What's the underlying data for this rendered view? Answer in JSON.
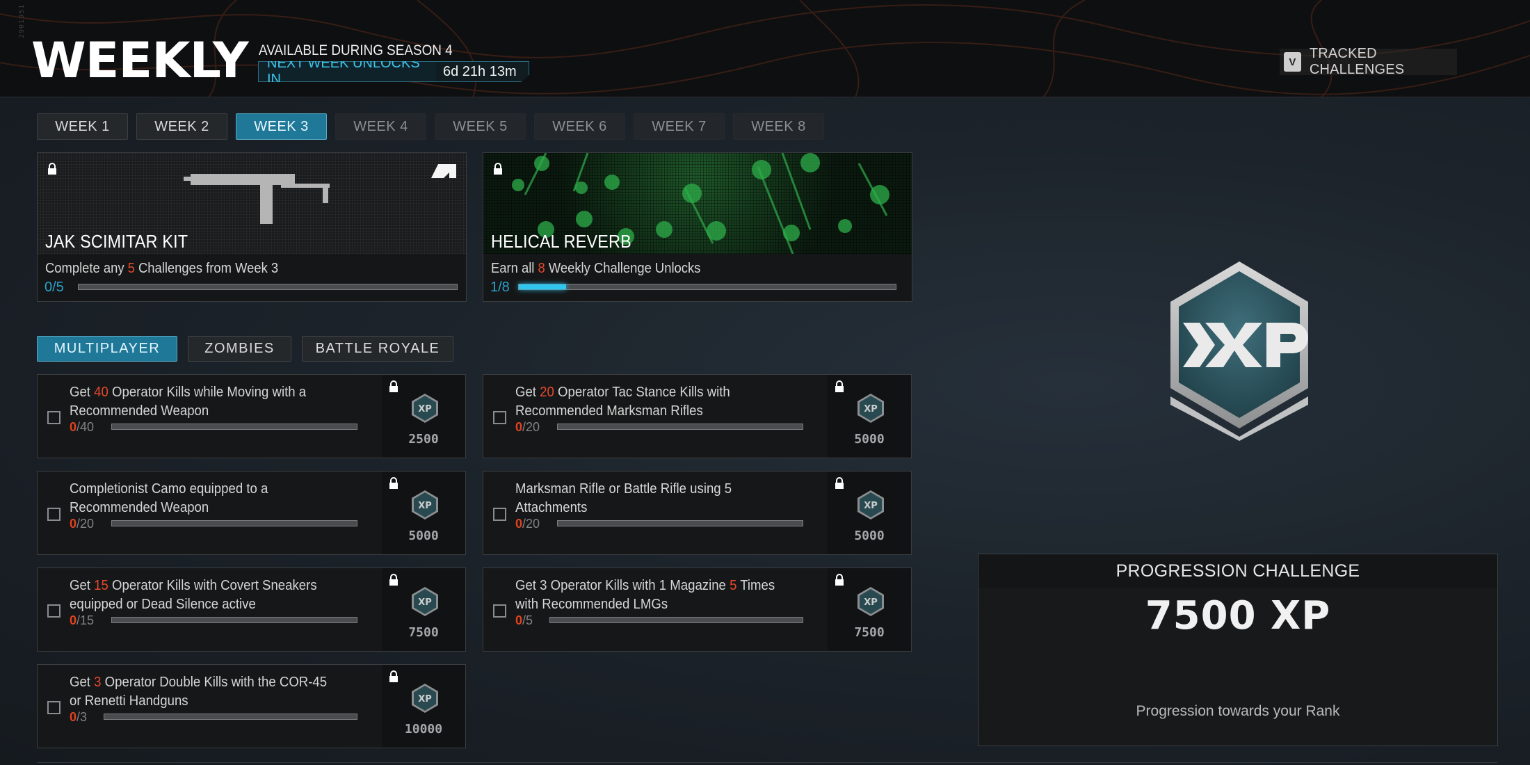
{
  "header": {
    "side_code": "2901951",
    "title": "WEEKLY",
    "availability": "AVAILABLE DURING SEASON 4",
    "unlock_label": "NEXT WEEK UNLOCKS IN",
    "unlock_time": "6d 21h 13m",
    "tracked": {
      "key": "V",
      "label": "TRACKED CHALLENGES"
    }
  },
  "weeks": [
    {
      "label": "WEEK 1",
      "state": "unlocked"
    },
    {
      "label": "WEEK 2",
      "state": "unlocked"
    },
    {
      "label": "WEEK 3",
      "state": "active"
    },
    {
      "label": "WEEK 4",
      "state": "locked"
    },
    {
      "label": "WEEK 5",
      "state": "locked"
    },
    {
      "label": "WEEK 6",
      "state": "locked"
    },
    {
      "label": "WEEK 7",
      "state": "locked"
    },
    {
      "label": "WEEK 8",
      "state": "locked"
    }
  ],
  "rewards": [
    {
      "title": "JAK SCIMITAR KIT",
      "desc_pre": "Complete any ",
      "desc_num": "5",
      "desc_post": " Challenges from Week 3",
      "progress_text": "0/5",
      "progress": 0,
      "total": 5
    },
    {
      "title": "HELICAL REVERB",
      "desc_pre": "Earn all ",
      "desc_num": "8",
      "desc_post": " Weekly Challenge Unlocks",
      "progress_text": "1/8",
      "progress": 1,
      "total": 8
    }
  ],
  "modes": [
    {
      "label": "MULTIPLAYER",
      "active": true
    },
    {
      "label": "ZOMBIES",
      "active": false
    },
    {
      "label": "BATTLE ROYALE",
      "active": false
    }
  ],
  "challenges": [
    {
      "pre": "Get ",
      "num": "40",
      "post": " Operator Kills while Moving with a Recommended Weapon",
      "current": "0",
      "total": "/40",
      "xp": "2500"
    },
    {
      "pre": "Get ",
      "num": "20",
      "post": " Operator Tac Stance Kills with Recommended Marksman Rifles",
      "current": "0",
      "total": "/20",
      "xp": "5000"
    },
    {
      "pre": "",
      "num": "",
      "post": "Completionist Camo equipped to a Recommended Weapon",
      "current": "0",
      "total": "/20",
      "xp": "5000"
    },
    {
      "pre": "",
      "num": "",
      "post": "Marksman Rifle or Battle Rifle using 5 Attachments",
      "current": "0",
      "total": "/20",
      "xp": "5000"
    },
    {
      "pre": "Get ",
      "num": "15",
      "post": " Operator Kills with Covert Sneakers equipped or Dead Silence active",
      "current": "0",
      "total": "/15",
      "xp": "7500"
    },
    {
      "pre": "Get 3 Operator Kills with 1 Magazine ",
      "num": "5",
      "post": " Times with Recommended LMGs",
      "current": "0",
      "total": "/5",
      "xp": "7500"
    },
    {
      "pre": "Get ",
      "num": "3",
      "post": " Operator Double Kills with the COR-45 or Renetti Handguns",
      "current": "0",
      "total": "/3",
      "xp": "10000"
    }
  ],
  "progression": {
    "heading": "PROGRESSION CHALLENGE",
    "amount": "7500 XP",
    "subtitle": "Progression towards your Rank"
  },
  "colors": {
    "accent": "#1f7898",
    "highlight": "#e5492b",
    "progress_fill": "#2fc7f0"
  }
}
